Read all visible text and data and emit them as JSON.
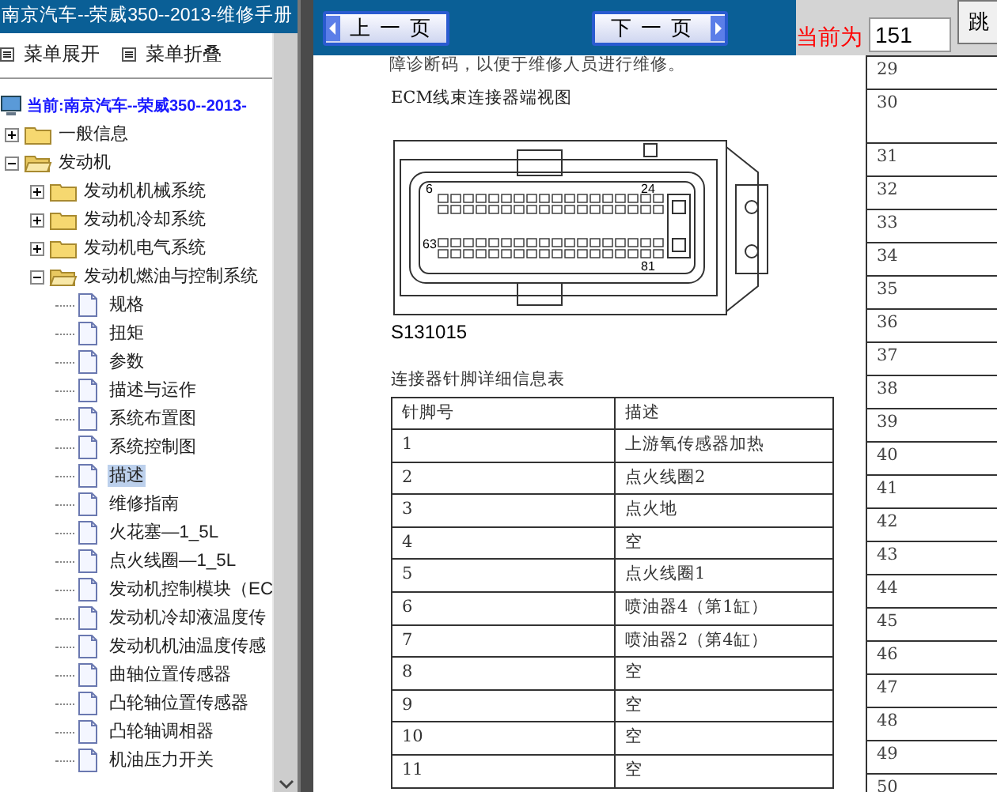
{
  "window": {
    "title": "南京汽车--荣威350--2013-维修手册"
  },
  "sidebar": {
    "menu_buttons": [
      "菜单展开",
      "菜单折叠"
    ],
    "root": "当前:南京汽车--荣威350--2013-",
    "tree": [
      {
        "kind": "folder",
        "label": "一般信息",
        "expanded": false,
        "selected": false
      },
      {
        "kind": "folder",
        "label": "发动机",
        "expanded": true,
        "selected": false,
        "children": [
          {
            "kind": "folder",
            "label": "发动机机械系统",
            "expanded": false,
            "selected": false
          },
          {
            "kind": "folder",
            "label": "发动机冷却系统",
            "expanded": false,
            "selected": false
          },
          {
            "kind": "folder",
            "label": "发动机电气系统",
            "expanded": false,
            "selected": false
          },
          {
            "kind": "folder",
            "label": "发动机燃油与控制系统",
            "expanded": true,
            "selected": false,
            "children": [
              {
                "kind": "page",
                "label": "规格",
                "selected": false
              },
              {
                "kind": "page",
                "label": "扭矩",
                "selected": false
              },
              {
                "kind": "page",
                "label": "参数",
                "selected": false
              },
              {
                "kind": "page",
                "label": "描述与运作",
                "selected": false
              },
              {
                "kind": "page",
                "label": "系统布置图",
                "selected": false
              },
              {
                "kind": "page",
                "label": "系统控制图",
                "selected": false
              },
              {
                "kind": "page",
                "label": "描述",
                "selected": true
              },
              {
                "kind": "page",
                "label": "维修指南",
                "selected": false
              },
              {
                "kind": "page",
                "label": "火花塞—1_5L",
                "selected": false
              },
              {
                "kind": "page",
                "label": "点火线圈—1_5L",
                "selected": false
              },
              {
                "kind": "page",
                "label": "发动机控制模块（EC",
                "selected": false
              },
              {
                "kind": "page",
                "label": "发动机冷却液温度传",
                "selected": false
              },
              {
                "kind": "page",
                "label": "发动机机油温度传感",
                "selected": false
              },
              {
                "kind": "page",
                "label": "曲轴位置传感器",
                "selected": false
              },
              {
                "kind": "page",
                "label": "凸轮轴位置传感器",
                "selected": false
              },
              {
                "kind": "page",
                "label": "凸轮轴调相器",
                "selected": false
              },
              {
                "kind": "page",
                "label": "机油压力开关",
                "selected": false
              }
            ]
          }
        ]
      }
    ]
  },
  "toolbar": {
    "prev": "上一页",
    "next": "下一页",
    "current_label": "当前为",
    "page_input": "151",
    "go": "跳"
  },
  "document": {
    "top_line": "障诊断码，以便于维修人员进行维修。",
    "heading": "ECM线束连接器端视图",
    "pin_labels": [
      "6",
      "24",
      "63",
      "81"
    ],
    "figure_code": "S131015",
    "table_title": "连接器针脚详细信息表",
    "columns": [
      "针脚号",
      "描述"
    ],
    "rows": [
      [
        "1",
        "上游氧传感器加热"
      ],
      [
        "2",
        "点火线圈2"
      ],
      [
        "3",
        "点火地"
      ],
      [
        "4",
        "空"
      ],
      [
        "5",
        "点火线圈1"
      ],
      [
        "6",
        "喷油器4（第1缸）"
      ],
      [
        "7",
        "喷油器2（第4缸）"
      ],
      [
        "8",
        "空"
      ],
      [
        "9",
        "空"
      ],
      [
        "10",
        "空"
      ],
      [
        "11",
        "空"
      ]
    ]
  },
  "next_page": {
    "rows": [
      "29",
      "30",
      "31",
      "32",
      "33",
      "34",
      "35",
      "36",
      "37",
      "38",
      "39",
      "40",
      "41",
      "42",
      "43",
      "44",
      "45",
      "46",
      "47",
      "48",
      "49",
      "50"
    ]
  }
}
